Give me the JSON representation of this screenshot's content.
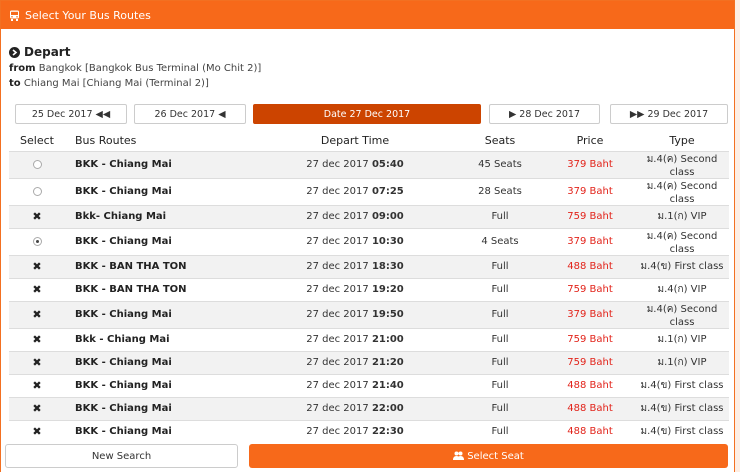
{
  "header": {
    "title": "Select Your Bus Routes"
  },
  "depart": {
    "title": "Depart",
    "from_label": "from",
    "from_value": "Bangkok [Bangkok Bus Terminal (Mo Chit 2)]",
    "to_label": "to",
    "to_value": "Chiang Mai [Chiang Mai (Terminal 2)]"
  },
  "dates": [
    {
      "label": "25 Dec 2017 ◀◀"
    },
    {
      "label": "26 Dec 2017 ◀"
    },
    {
      "label": "Date 27 Dec 2017"
    },
    {
      "label": "▶ 28 Dec 2017"
    },
    {
      "label": "▶▶ 29 Dec 2017"
    }
  ],
  "table": {
    "columns": [
      "Select",
      "Bus Routes",
      "Depart Time",
      "Seats",
      "Price",
      "Type"
    ],
    "rows": [
      {
        "select": "radio",
        "route": "BKK - Chiang Mai",
        "date": "27 dec 2017",
        "time": "05:40",
        "seats": "45 Seats",
        "price": "379 Baht",
        "type": "ม.4(ค) Second class"
      },
      {
        "select": "radio",
        "route": "BKK - Chiang Mai",
        "date": "27 dec 2017",
        "time": "07:25",
        "seats": "28 Seats",
        "price": "379 Baht",
        "type": "ม.4(ค) Second class"
      },
      {
        "select": "x",
        "route": "Bkk- Chiang Mai",
        "date": "27 dec 2017",
        "time": "09:00",
        "seats": "Full",
        "price": "759 Baht",
        "type": "ม.1(ก) VIP"
      },
      {
        "select": "radio-checked",
        "route": "BKK - Chiang Mai",
        "date": "27 dec 2017",
        "time": "10:30",
        "seats": "4 Seats",
        "price": "379 Baht",
        "type": "ม.4(ค) Second class"
      },
      {
        "select": "x",
        "route": "BKK - BAN THA TON",
        "date": "27 dec 2017",
        "time": "18:30",
        "seats": "Full",
        "price": "488 Baht",
        "type": "ม.4(ข) First class"
      },
      {
        "select": "x",
        "route": "BKK - BAN THA TON",
        "date": "27 dec 2017",
        "time": "19:20",
        "seats": "Full",
        "price": "759 Baht",
        "type": "ม.4(ก) VIP"
      },
      {
        "select": "x",
        "route": "BKK - Chiang Mai",
        "date": "27 dec 2017",
        "time": "19:50",
        "seats": "Full",
        "price": "379 Baht",
        "type": "ม.4(ค) Second class"
      },
      {
        "select": "x",
        "route": "Bkk - Chiang Mai",
        "date": "27 dec 2017",
        "time": "21:00",
        "seats": "Full",
        "price": "759 Baht",
        "type": "ม.1(ก) VIP"
      },
      {
        "select": "x",
        "route": "BKK - Chiang Mai",
        "date": "27 dec 2017",
        "time": "21:20",
        "seats": "Full",
        "price": "759 Baht",
        "type": "ม.1(ก) VIP"
      },
      {
        "select": "x",
        "route": "BKK - Chiang Mai",
        "date": "27 dec 2017",
        "time": "21:40",
        "seats": "Full",
        "price": "488 Baht",
        "type": "ม.4(ข) First class"
      },
      {
        "select": "x",
        "route": "BKK - Chiang Mai",
        "date": "27 dec 2017",
        "time": "22:00",
        "seats": "Full",
        "price": "488 Baht",
        "type": "ม.4(ข) First class"
      },
      {
        "select": "x",
        "route": "BKK - Chiang Mai",
        "date": "27 dec 2017",
        "time": "22:30",
        "seats": "Full",
        "price": "488 Baht",
        "type": "ม.4(ข) First class"
      }
    ]
  },
  "actions": {
    "new_search": "New Search",
    "select_seat": "Select Seat"
  },
  "icons": {
    "header": "bus-icon",
    "depart": "circle-arrow-right-icon",
    "select_seat": "users-icon",
    "unavailable": "times-icon"
  },
  "colors": {
    "accent": "#f7691a",
    "active_date": "#cc4400",
    "price": "#e2231a"
  }
}
